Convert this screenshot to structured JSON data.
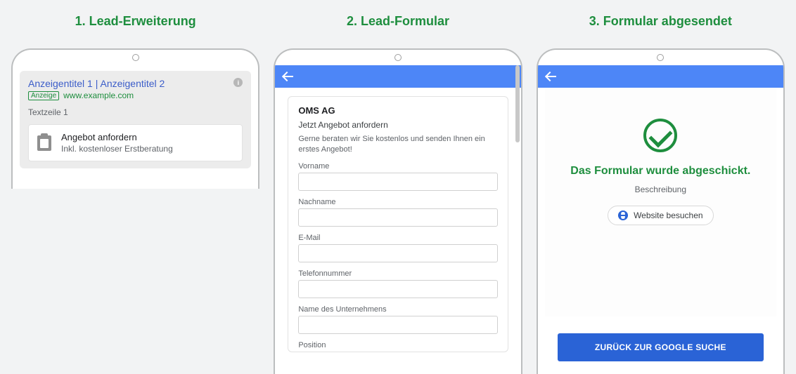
{
  "columns": {
    "c1": {
      "title": "1. Lead-Erweiterung"
    },
    "c2": {
      "title": "2. Lead-Formular"
    },
    "c3": {
      "title": "3. Formular abgesendet"
    }
  },
  "ad": {
    "title": "Anzeigentitel 1 | Anzeigentitel 2",
    "badge": "Anzeige",
    "url": "www.example.com",
    "desc": "Textzeile 1",
    "cta_title": "Angebot anfordern",
    "cta_sub": "Inkl. kostenloser Erstberatung"
  },
  "form": {
    "company": "OMS AG",
    "subtitle": "Jetzt Angebot anfordern",
    "intro": "Gerne beraten wir Sie kostenlos und senden Ihnen ein erstes Angebot!",
    "fields": {
      "f0": "Vorname",
      "f1": "Nachname",
      "f2": "E-Mail",
      "f3": "Telefonnummer",
      "f4": "Name des Unternehmens",
      "f5": "Position"
    }
  },
  "success": {
    "title": "Das Formular wurde abgeschickt.",
    "desc": "Beschreibung",
    "visit": "Website besuchen",
    "back": "ZURÜCK ZUR GOOGLE SUCHE"
  }
}
